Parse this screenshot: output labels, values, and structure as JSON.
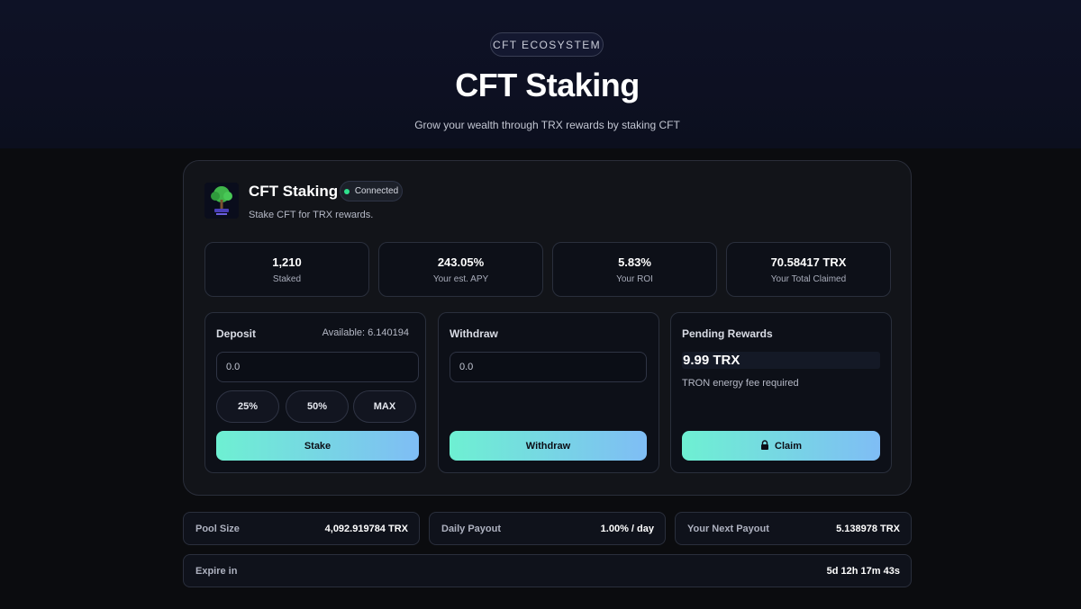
{
  "hero": {
    "badge": "CFT ECOSYSTEM",
    "title": "CFT Staking",
    "subtitle": "Grow your wealth through TRX rewards by staking CFT"
  },
  "card": {
    "title": "CFT Staking",
    "status": "Connected",
    "status_color": "#2fe08d",
    "subtitle": "Stake CFT for TRX rewards.",
    "logo_icon": "tree-logo-icon"
  },
  "stats": [
    {
      "value": "1,210",
      "label": "Staked"
    },
    {
      "value": "243.05%",
      "label": "Your est. APY"
    },
    {
      "value": "5.83%",
      "label": "Your ROI"
    },
    {
      "value": "70.58417 TRX",
      "label": "Your Total Claimed"
    }
  ],
  "deposit": {
    "title": "Deposit",
    "available": "Available: 6.140194",
    "placeholder": "0.0",
    "presets": [
      "25%",
      "50%",
      "MAX"
    ],
    "button": "Stake"
  },
  "withdraw": {
    "title": "Withdraw",
    "placeholder": "0.0",
    "button": "Withdraw"
  },
  "rewards": {
    "title": "Pending Rewards",
    "value": "9.99 TRX",
    "note": "TRON energy fee required",
    "button": "Claim",
    "button_icon": "lock-icon"
  },
  "info": {
    "pool_size_label": "Pool Size",
    "pool_size_value": "4,092.919784 TRX",
    "daily_payout_label": "Daily Payout",
    "daily_payout_value": "1.00% / day",
    "next_payout_label": "Your Next Payout",
    "next_payout_value": "5.138978 TRX",
    "expire_label": "Expire in",
    "expire_value": "5d 12h 17m 43s"
  },
  "colors": {
    "button_gradient_start": "#6ef0d2",
    "button_gradient_end": "#7fbdf5",
    "background": "#0b0c0f"
  }
}
